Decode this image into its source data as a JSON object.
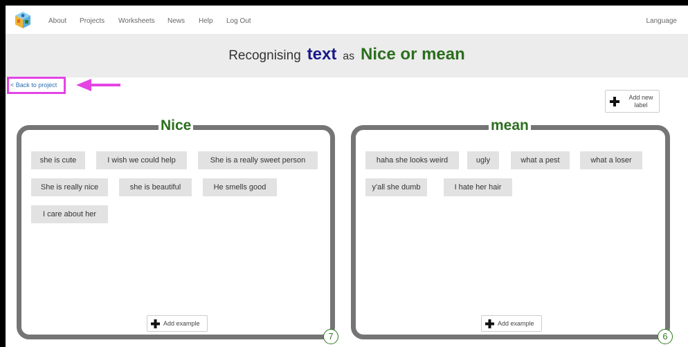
{
  "nav": {
    "items": [
      "About",
      "Projects",
      "Worksheets",
      "News",
      "Help",
      "Log Out"
    ],
    "language": "Language"
  },
  "title": {
    "recognising": "Recognising",
    "type": "text",
    "as": "as",
    "labels": "Nice or mean"
  },
  "back_link": "< Back to project",
  "add_label": {
    "line1": "Add new",
    "line2": "label"
  },
  "buckets": [
    {
      "label": "Nice",
      "count": "7",
      "add_example": "Add example",
      "examples": [
        "she is cute",
        "I wish we could help",
        "She is a really sweet person",
        "She is really nice",
        "she is beautiful",
        "He smells good",
        "I care about her"
      ]
    },
    {
      "label": "mean",
      "count": "6",
      "add_example": "Add example",
      "examples": [
        "haha she looks weird",
        "ugly",
        "what a pest",
        "what a loser",
        "y'all she dumb",
        "I hate her hair"
      ]
    }
  ],
  "colors": {
    "label_green": "#2b6e1e",
    "type_blue": "#1a1a8a",
    "highlight_magenta": "#e544e5",
    "link_blue": "#2a6db3"
  }
}
